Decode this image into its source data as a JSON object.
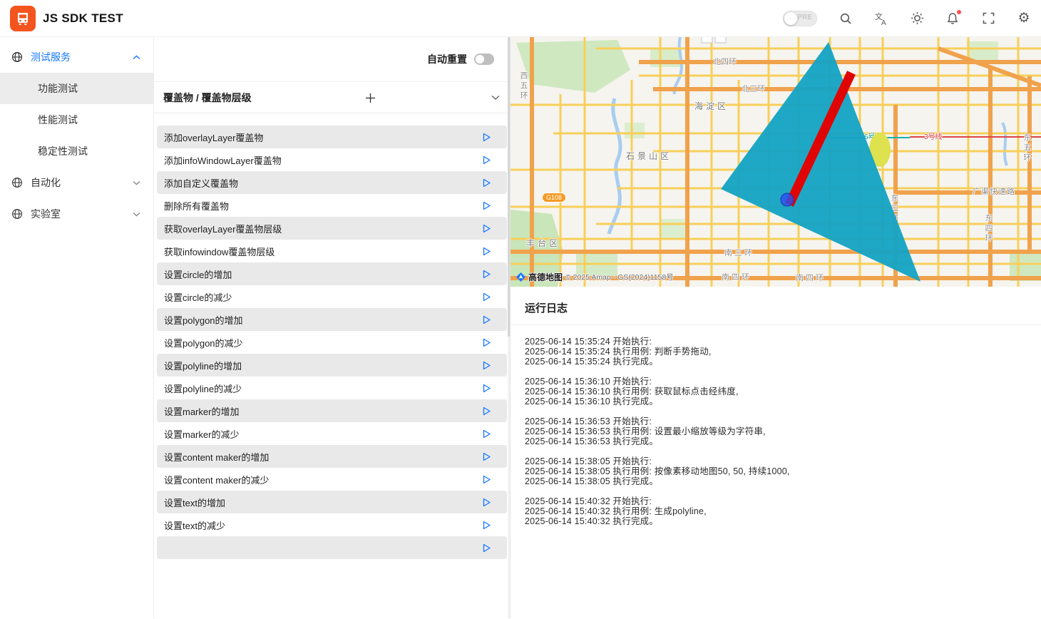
{
  "header": {
    "title": "JS SDK TEST",
    "env_label": "PRE"
  },
  "sidebar": {
    "sections": [
      {
        "label": "测试服务",
        "expanded": true
      },
      {
        "label": "自动化",
        "expanded": false
      },
      {
        "label": "实验室",
        "expanded": false
      }
    ],
    "children": [
      {
        "label": "功能测试",
        "active": true
      },
      {
        "label": "性能测试",
        "active": false
      },
      {
        "label": "稳定性测试",
        "active": false
      }
    ]
  },
  "panel": {
    "auto_reset_label": "自动重置",
    "group_title": "覆盖物 / 覆盖物层级",
    "items": [
      {
        "label": "添加overlayLayer覆盖物"
      },
      {
        "label": "添加infoWindowLayer覆盖物"
      },
      {
        "label": "添加自定义覆盖物"
      },
      {
        "label": "删除所有覆盖物"
      },
      {
        "label": "获取overlayLayer覆盖物层级"
      },
      {
        "label": "获取infowindow覆盖物层级"
      },
      {
        "label": "设置circle的增加"
      },
      {
        "label": "设置circle的减少"
      },
      {
        "label": "设置polygon的增加"
      },
      {
        "label": "设置polygon的减少"
      },
      {
        "label": "设置polyline的增加"
      },
      {
        "label": "设置polyline的减少"
      },
      {
        "label": "设置marker的增加"
      },
      {
        "label": "设置marker的减少"
      },
      {
        "label": "设置content maker的增加"
      },
      {
        "label": "设置content maker的减少"
      },
      {
        "label": "设置text的增加"
      },
      {
        "label": "设置text的减少"
      },
      {
        "label": ""
      }
    ]
  },
  "map": {
    "labels": {
      "ring_n4": "北四环",
      "ring_n3": "北三环",
      "haidian": "海淀区",
      "ring_w5": "西五环",
      "shijingshan": "石景山区",
      "fengtai": "丰台区",
      "ring_s3": "南三环",
      "ring_s4_a": "南四环",
      "ring_s4_b": "南四环",
      "ring_e5": "东五环",
      "ring_e4": "东四环",
      "ring_e3": "东三环",
      "guangqu": "广渠快速路",
      "g108": "G108",
      "metro3": "3号线",
      "metro6": "6号线"
    },
    "attribution": {
      "brand": "高德地图",
      "copyright": "© 2025 Amap - GS(2024)1158号"
    }
  },
  "log": {
    "title": "运行日志",
    "entries": [
      [
        "2025-06-14 15:35:24 开始执行:",
        "2025-06-14 15:35:24 执行用例: 判断手势拖动,",
        "2025-06-14 15:35:24 执行完成。"
      ],
      [
        "2025-06-14 15:36:10 开始执行:",
        "2025-06-14 15:36:10 执行用例: 获取鼠标点击经纬度,",
        "2025-06-14 15:36:10 执行完成。"
      ],
      [
        "2025-06-14 15:36:53 开始执行:",
        "2025-06-14 15:36:53 执行用例: 设置最小缩放等级为字符串,",
        "2025-06-14 15:36:53 执行完成。"
      ],
      [
        "2025-06-14 15:38:05 开始执行:",
        "2025-06-14 15:38:05 执行用例: 按像素移动地图50, 50, 持续1000,",
        "2025-06-14 15:38:05 执行完成。"
      ],
      [
        "2025-06-14 15:40:32 开始执行:",
        "2025-06-14 15:40:32 执行用例: 生成polyline,",
        "2025-06-14 15:40:32 执行完成。"
      ]
    ]
  },
  "colors": {
    "accent": "#1677ff",
    "logo": "#f4541e",
    "overlay_polygon": "#16a3c4",
    "overlay_line": "#e00505",
    "overlay_marker": "#2b4ff0",
    "stripe": "#e9e9e9"
  }
}
